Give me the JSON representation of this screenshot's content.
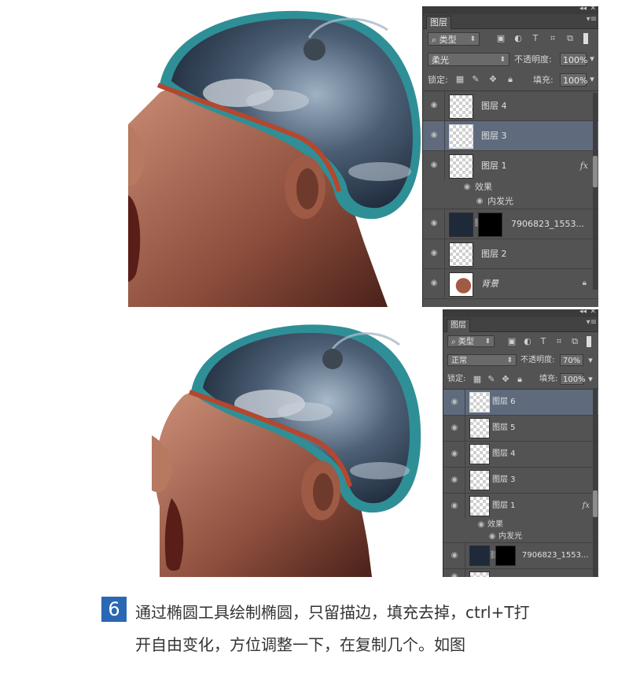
{
  "screenshot1": {
    "panel": {
      "tab": "图层",
      "filter_kind": "类型",
      "blend_mode": "柔光",
      "opacity_label": "不透明度:",
      "opacity_value": "100%",
      "lock_label": "锁定:",
      "fill_label": "填充:",
      "fill_value": "100%",
      "layers": [
        {
          "name": "图层 4"
        },
        {
          "name": "图层 3"
        },
        {
          "name": "图层 1"
        },
        {
          "name": "7906823_1553..."
        },
        {
          "name": "图层 2"
        },
        {
          "name": "背景"
        }
      ],
      "effects_label": "效果",
      "inner_glow_label": "内发光",
      "fx_label": "fx"
    }
  },
  "screenshot2": {
    "panel": {
      "tab": "图层",
      "filter_kind": "类型",
      "blend_mode": "正常",
      "opacity_label": "不透明度:",
      "opacity_value": "70%",
      "lock_label": "锁定:",
      "fill_label": "填充:",
      "fill_value": "100%",
      "layers": [
        {
          "name": "图层 6"
        },
        {
          "name": "图层 5"
        },
        {
          "name": "图层 4"
        },
        {
          "name": "图层 3"
        },
        {
          "name": "图层 1"
        },
        {
          "name": "7906823_1553..."
        }
      ],
      "effects_label": "效果",
      "inner_glow_label": "内发光",
      "fx_label": "fx"
    }
  },
  "step": {
    "number": "6",
    "line1": "通过椭圆工具绘制椭圆，只留描边，填充去掉，ctrl+T打",
    "line2": "开自由变化，方位调整一下，在复制几个。如图"
  },
  "colors": {
    "panel_bg": "#535353",
    "active_layer": "#5f6b7d",
    "badge": "#2a68b3",
    "helmet": "#2f8f96"
  }
}
